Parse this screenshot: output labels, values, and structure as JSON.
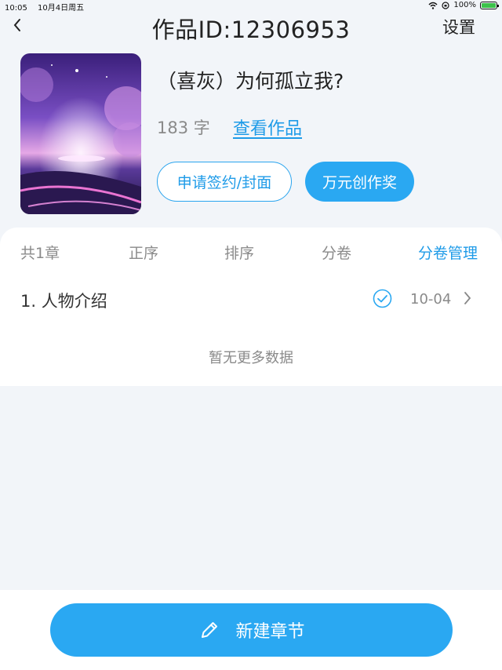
{
  "status_bar": {
    "time": "10:05",
    "date": "10月4日周五",
    "battery": "100%"
  },
  "nav": {
    "back_icon": "chevron-left-icon",
    "title": "作品ID:12306953",
    "settings_label": "设置"
  },
  "work": {
    "title": "（喜灰）为何孤立我?",
    "word_count": "183 字",
    "view_label": "查看作品",
    "sign_label": "申请签约/封面",
    "award_label": "万元创作奖"
  },
  "toolbar": {
    "total": "共1章",
    "order": "正序",
    "sort": "排序",
    "volume": "分卷",
    "manage": "分卷管理"
  },
  "chapters": [
    {
      "title": "1. 人物介绍",
      "date": "10-04",
      "status_icon": "check-circle-icon"
    }
  ],
  "no_more_text": "暂无更多数据",
  "new_chapter_label": "新建章节",
  "colors": {
    "accent": "#2aa8f2",
    "link": "#1e9be8",
    "background": "#f2f5f9"
  }
}
